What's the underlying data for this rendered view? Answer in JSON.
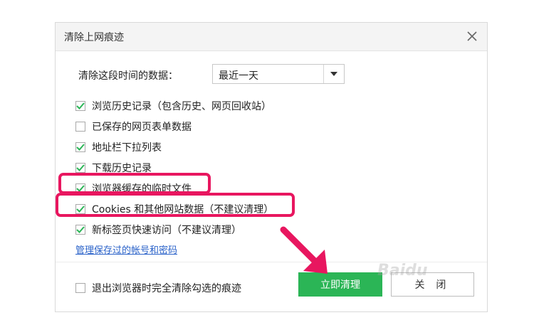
{
  "dialog": {
    "title": "清除上网痕迹",
    "close_icon": "close-icon"
  },
  "range": {
    "label": "清除这段时间的数据：",
    "selected": "最近一天"
  },
  "options": [
    {
      "label": "浏览历史记录（包含历史、网页回收站）",
      "checked": true
    },
    {
      "label": "已保存的网页表单数据",
      "checked": false
    },
    {
      "label": "地址栏下拉列表",
      "checked": true
    },
    {
      "label": "下载历史记录",
      "checked": true
    },
    {
      "label": "浏览器缓存的临时文件",
      "checked": true
    },
    {
      "label": "Cookies 和其他网站数据（不建议清理）",
      "checked": true
    },
    {
      "label": "新标签页快速访问（不建议清理）",
      "checked": true
    }
  ],
  "manage_link": "管理保存过的帐号和密码",
  "footer": {
    "exit_label": "退出浏览器时完全清除勾选的痕迹",
    "exit_checked": false,
    "clear_button": "立即清理",
    "close_button": "关 闭"
  },
  "colors": {
    "accent_green": "#2bb556",
    "highlight_pink": "#e8165f",
    "link_blue": "#2a62c9"
  }
}
